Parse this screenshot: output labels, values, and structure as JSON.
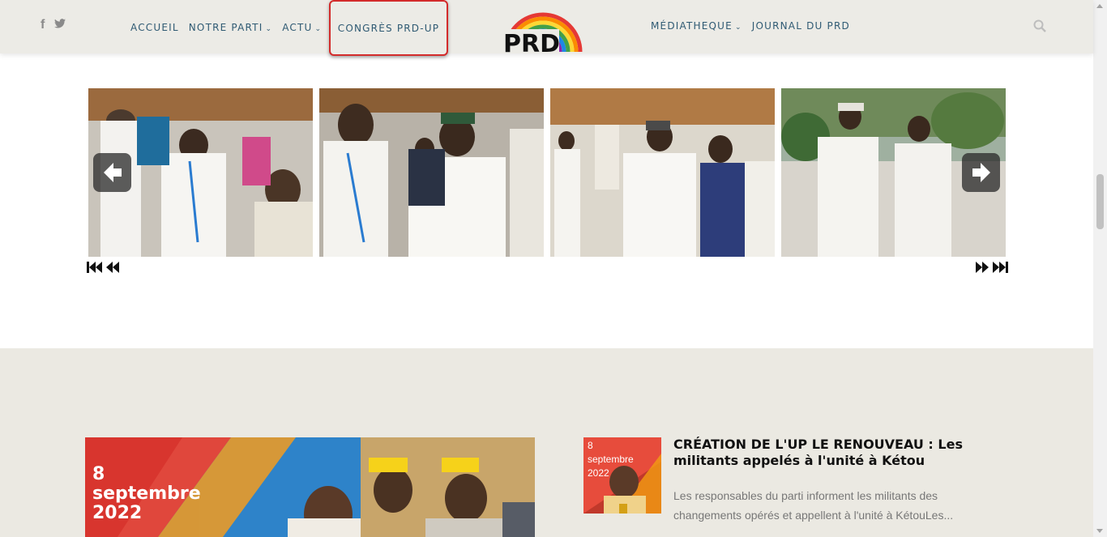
{
  "header": {
    "social": [
      {
        "icon": "facebook-icon",
        "glyph": "f"
      },
      {
        "icon": "twitter-icon",
        "glyph": "t"
      }
    ],
    "nav_left": [
      {
        "label": "ACCUEIL",
        "has_dropdown": false
      },
      {
        "label": "NOTRE PARTI",
        "has_dropdown": true
      },
      {
        "label": "ACTU",
        "has_dropdown": true
      }
    ],
    "nav_highlight": {
      "label": "CONGRÈS PRD-UP",
      "border_color": "#d32b2b"
    },
    "logo": {
      "text": "PRD"
    },
    "nav_right": [
      {
        "label": "MÉDIATHEQUE",
        "has_dropdown": true
      },
      {
        "label": "JOURNAL DU PRD",
        "has_dropdown": false
      }
    ],
    "search_icon": "search-icon"
  },
  "gallery": {
    "photos": [
      {
        "alt": "photo-1"
      },
      {
        "alt": "photo-2"
      },
      {
        "alt": "photo-3"
      },
      {
        "alt": "photo-4"
      }
    ],
    "prev_icon": "arrow-left-icon",
    "next_icon": "arrow-right-icon",
    "controls": {
      "first": "⏮",
      "prev": "◀◀",
      "next": "▶▶",
      "last": "⏭"
    }
  },
  "news": {
    "featured": {
      "date_lines": [
        "8",
        "septembre",
        "2022"
      ]
    },
    "article": {
      "date_lines": [
        "8",
        "septembre",
        "2022"
      ],
      "title": "CRÉATION DE L'UP LE RENOUVEAU : Les militants appelés à l'unité à Kétou",
      "excerpt": "Les responsables du parti informent les militants des changements opérés et appellent à l'unité à KétouLes..."
    }
  },
  "colors": {
    "header_bg": "#ecebe6",
    "nav_text": "#2f5a73",
    "section_bg": "#ebe9e2",
    "accent_red": "#d32b2b"
  }
}
